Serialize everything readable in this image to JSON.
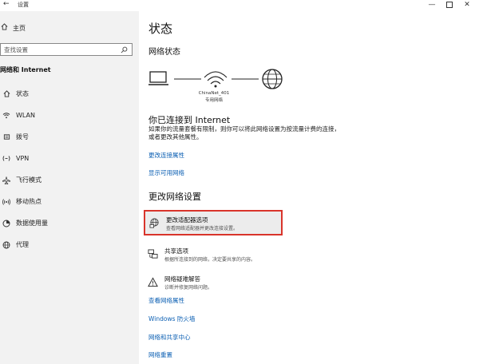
{
  "window": {
    "back_glyph": "←",
    "title": "设置",
    "minimize_glyph": "—",
    "close_glyph": "✕"
  },
  "sidebar": {
    "home_label": "主页",
    "search_placeholder": "查找设置",
    "section_title": "网络和 Internet",
    "items": [
      {
        "label": "状态",
        "icon": "home-icon"
      },
      {
        "label": "WLAN",
        "icon": "wifi-icon"
      },
      {
        "label": "拨号",
        "icon": "dialup-icon"
      },
      {
        "label": "VPN",
        "icon": "vpn-icon"
      },
      {
        "label": "飞行模式",
        "icon": "airplane-icon"
      },
      {
        "label": "移动热点",
        "icon": "hotspot-icon"
      },
      {
        "label": "数据使用量",
        "icon": "data-usage-icon"
      },
      {
        "label": "代理",
        "icon": "proxy-globe-icon"
      }
    ]
  },
  "main": {
    "title": "状态",
    "network_status_heading": "网络状态",
    "network_name": "ChinaNet_401",
    "network_type": "专用网络",
    "connected_title": "你已连接到 Internet",
    "connected_desc": "如果你的流量套餐有限制，则你可以将此网络设置为按流量计费的连接，或者更改其他属性。",
    "links_top": [
      "更改连接属性",
      "显示可用网络"
    ],
    "change_heading": "更改网络设置",
    "options": [
      {
        "title": "更改适配器选项",
        "desc": "查看网络适配器并更改连接设置。",
        "icon": "adapter-icon"
      },
      {
        "title": "共享选项",
        "desc": "根据所连接到的网络，决定要共享的内容。",
        "icon": "sharing-icon"
      },
      {
        "title": "网络疑难解答",
        "desc": "诊断并修复网络问题。",
        "icon": "warning-icon"
      }
    ],
    "links_bottom": [
      "查看网络属性",
      "Windows 防火墙",
      "网络和共享中心",
      "网络重置"
    ]
  },
  "colors": {
    "accent_link": "#0b5fb3",
    "highlight_border": "#d9342b",
    "sidebar_bg": "#f2f2f2"
  }
}
